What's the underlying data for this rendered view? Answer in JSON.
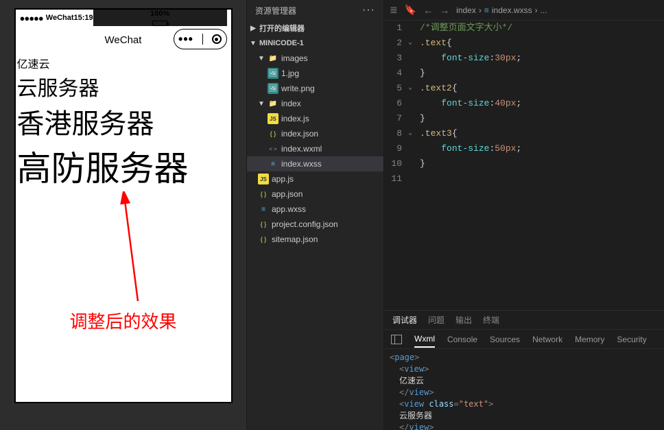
{
  "simulator": {
    "carrier_dots": "●●●●●",
    "carrier": "WeChat",
    "time": "15:19",
    "battery_pct": "100%",
    "navbar_title": "WeChat",
    "page_lines": [
      "亿速云",
      "云服务器",
      "香港服务器",
      "高防服务器"
    ],
    "annotation": "调整后的效果"
  },
  "explorer": {
    "title": "资源管理器",
    "open_editors": "打开的编辑器",
    "project": "MINICODE-1",
    "tree": {
      "images": {
        "label": "images",
        "children": [
          "1.jpg",
          "write.png"
        ]
      },
      "index": {
        "label": "index",
        "children": [
          "index.js",
          "index.json",
          "index.wxml",
          "index.wxss"
        ]
      },
      "root_files": [
        "app.js",
        "app.json",
        "app.wxss",
        "project.config.json",
        "sitemap.json"
      ]
    },
    "selected": "index.wxss"
  },
  "editor": {
    "breadcrumb": [
      "index",
      "index.wxss",
      "..."
    ],
    "code_lines": [
      {
        "n": 1,
        "type": "comment",
        "text": "/*调整页面文字大小*/"
      },
      {
        "n": 2,
        "type": "sel-open",
        "fold": true,
        "sel": ".text"
      },
      {
        "n": 3,
        "type": "decl",
        "prop": "font-size",
        "val": "30",
        "unit": "px"
      },
      {
        "n": 4,
        "type": "close"
      },
      {
        "n": 5,
        "type": "sel-open",
        "fold": true,
        "sel": ".text2"
      },
      {
        "n": 6,
        "type": "decl",
        "prop": "font-size",
        "val": "40",
        "unit": "px"
      },
      {
        "n": 7,
        "type": "close"
      },
      {
        "n": 8,
        "type": "sel-open",
        "fold": true,
        "sel": ".text3"
      },
      {
        "n": 9,
        "type": "decl",
        "prop": "font-size",
        "val": "50",
        "unit": "px"
      },
      {
        "n": 10,
        "type": "close"
      },
      {
        "n": 11,
        "type": "blank"
      }
    ]
  },
  "debugger": {
    "tabs1": [
      "调试器",
      "问题",
      "输出",
      "终端"
    ],
    "tabs1_active": "调试器",
    "tabs2": [
      "Wxml",
      "Console",
      "Sources",
      "Network",
      "Memory",
      "Security"
    ],
    "tabs2_active": "Wxml",
    "wxml": {
      "root": "page",
      "view1_text": "亿速云",
      "view2_class": "text",
      "view2_text": "云服务器"
    }
  }
}
